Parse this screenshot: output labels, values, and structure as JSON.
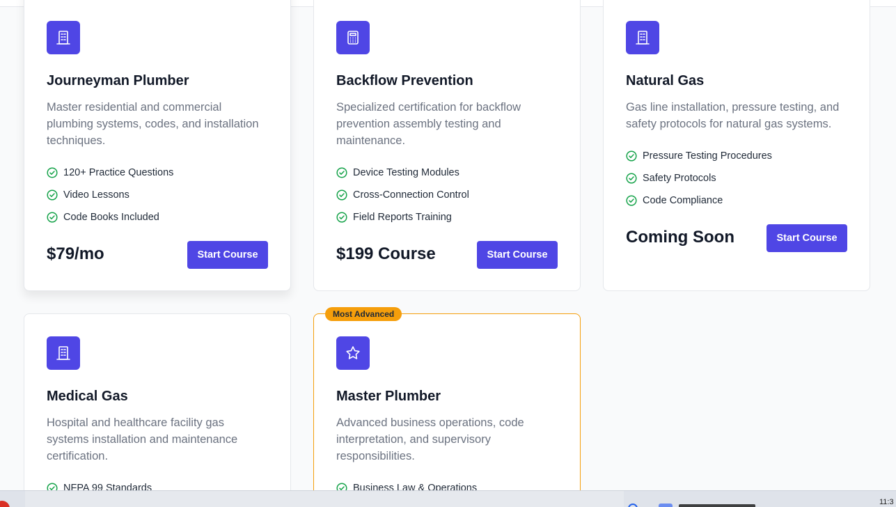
{
  "colors": {
    "accent": "#4f46e5",
    "check": "#16a34a",
    "featured_border": "#f59e0b",
    "badge": "#f59e0b"
  },
  "courses": [
    {
      "icon": "building-icon",
      "title": "Journeyman Plumber",
      "description": "Master residential and commercial plumbing systems, codes, and installation techniques.",
      "features": [
        "120+ Practice Questions",
        "Video Lessons",
        "Code Books Included"
      ],
      "price": "$79/mo",
      "button": "Start Course"
    },
    {
      "icon": "calculator-icon",
      "title": "Backflow Prevention",
      "description": "Specialized certification for backflow prevention assembly testing and maintenance.",
      "features": [
        "Device Testing Modules",
        "Cross-Connection Control",
        "Field Reports Training"
      ],
      "price": "$199 Course",
      "button": "Start Course"
    },
    {
      "icon": "building-icon",
      "title": "Natural Gas",
      "description": "Gas line installation, pressure testing, and safety protocols for natural gas systems.",
      "features": [
        "Pressure Testing Procedures",
        "Safety Protocols",
        "Code Compliance"
      ],
      "price": "Coming Soon",
      "button": "Start Course"
    },
    {
      "icon": "building-icon",
      "title": "Medical Gas",
      "description": "Hospital and healthcare facility gas systems installation and maintenance certification.",
      "features": [
        "NFPA 99 Standards"
      ]
    },
    {
      "icon": "star-icon",
      "badge": "Most Advanced",
      "title": "Master Plumber",
      "description": "Advanced business operations, code interpretation, and supervisory responsibilities.",
      "features": [
        "Business Law & Operations"
      ]
    }
  ],
  "taskbar": {
    "clock": "11:3"
  }
}
